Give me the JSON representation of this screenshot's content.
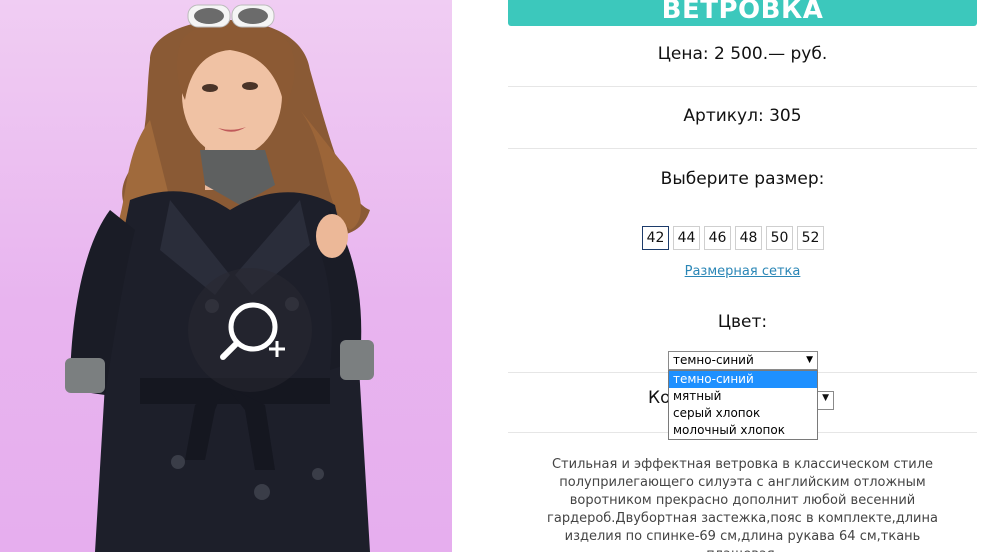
{
  "product": {
    "title": "ВЕТРОВКА",
    "price": "Цена: 2 500.— руб.",
    "article": "Артикул: 305",
    "size_header": "Выберите размер:",
    "sizes": [
      "42",
      "44",
      "46",
      "48",
      "50",
      "52"
    ],
    "size_chart_link": "Размерная сетка",
    "color_header": "Цвет:",
    "color_selected": "темно-синий",
    "color_options": [
      "темно-синий",
      "мятный",
      "серый хлопок",
      "молочный хлопок"
    ],
    "quantity_label_partial": "Ко",
    "description": "Стильная и эффектная ветровка в классическом стиле полуприлегающего силуэта с английским отложным воротником прекрасно дополнит любой весенний гардероб.Двубортная застежка,пояс в комплекте,длина изделия по спинке-69 см,длина рукава 64 см,ткань плащевая."
  },
  "icons": {
    "zoom": "zoom-in-icon",
    "dropdown_arrow": "▼"
  },
  "colors": {
    "accent": "#3cc8bc",
    "link": "#2a86b6",
    "active_border": "#1c3b6a",
    "dropdown_highlight": "#1e90ff"
  }
}
